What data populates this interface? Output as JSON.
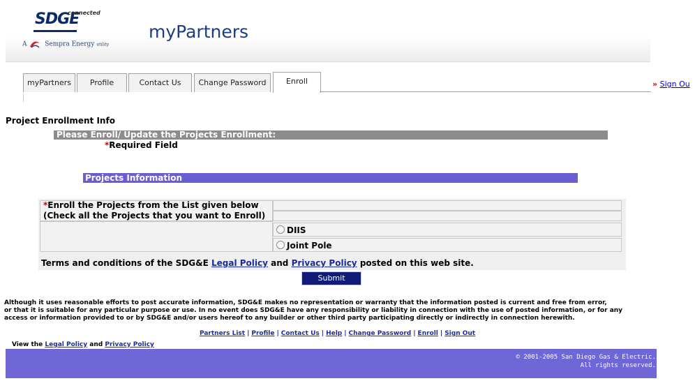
{
  "header": {
    "logo_sdge": "SDGE",
    "logo_connected": "connected",
    "logo_sempra_prefix": "A",
    "logo_sempra": "Sempra Energy",
    "logo_sempra_suffix": "utility",
    "app_title": "myPartners"
  },
  "tabs": [
    {
      "label": "myPartners",
      "active": false
    },
    {
      "label": "Profile",
      "active": false
    },
    {
      "label": "Contact Us",
      "active": false
    },
    {
      "label": "Change Password",
      "active": false
    },
    {
      "label": "Enroll",
      "active": true
    }
  ],
  "signout": {
    "chevron": "»",
    "label": "Sign Ou"
  },
  "page": {
    "section_title": "Project Enrollment Info",
    "enroll_header": "Please Enroll/ Update the Projects Enrollment:",
    "required_star": "*",
    "required_label": "Required Field",
    "projects_header": "Projects Information"
  },
  "form": {
    "enroll_star": "*",
    "enroll_line1": "Enroll the Projects from the List given below",
    "enroll_line2": "(Check all the Projects that you want to Enroll)",
    "options": [
      {
        "label": "DIIS",
        "selected": false
      },
      {
        "label": "Joint Pole",
        "selected": false
      }
    ],
    "terms_prefix": "Terms and conditions of the SDG&E",
    "terms_legal": "Legal Policy",
    "terms_and": "and",
    "terms_privacy": "Privacy Policy",
    "terms_suffix": "posted on this web site.",
    "submit_label": "Submit"
  },
  "disclaimer": {
    "line1": "Although it uses reasonable efforts to post accurate information, SDG&E makes no representation or warranty that the information posted is current and free from error,",
    "line2": "or that it is suitable for any particular purpose or use. In no event does SDG&E have any responsibility or liability in connection with the use of posted information, or for any",
    "line3": "access or information provided to or by SDG&E and/or users hereof to any builder or other third party participating directly or indirectly in connection herewith."
  },
  "footer": {
    "links": [
      "Partners List",
      "Profile",
      "Contact Us",
      "Help",
      "Change Password",
      "Enroll",
      "Sign Out"
    ],
    "separator": "|",
    "view_prefix": "View the",
    "view_legal": "Legal Policy",
    "view_and": "and",
    "view_privacy": "Privacy Policy",
    "copyright_line1": "© 2001-2005 San Diego Gas & Electric.",
    "copyright_line2": "All rights reserved."
  },
  "colors": {
    "grey_bar": "#8c8c8c",
    "purple_bar": "#6a5dd2",
    "submit_bg": "#101c78",
    "footer_bar": "#7067d6",
    "required_star": "#cc0000",
    "link": "#1a2c9e"
  }
}
